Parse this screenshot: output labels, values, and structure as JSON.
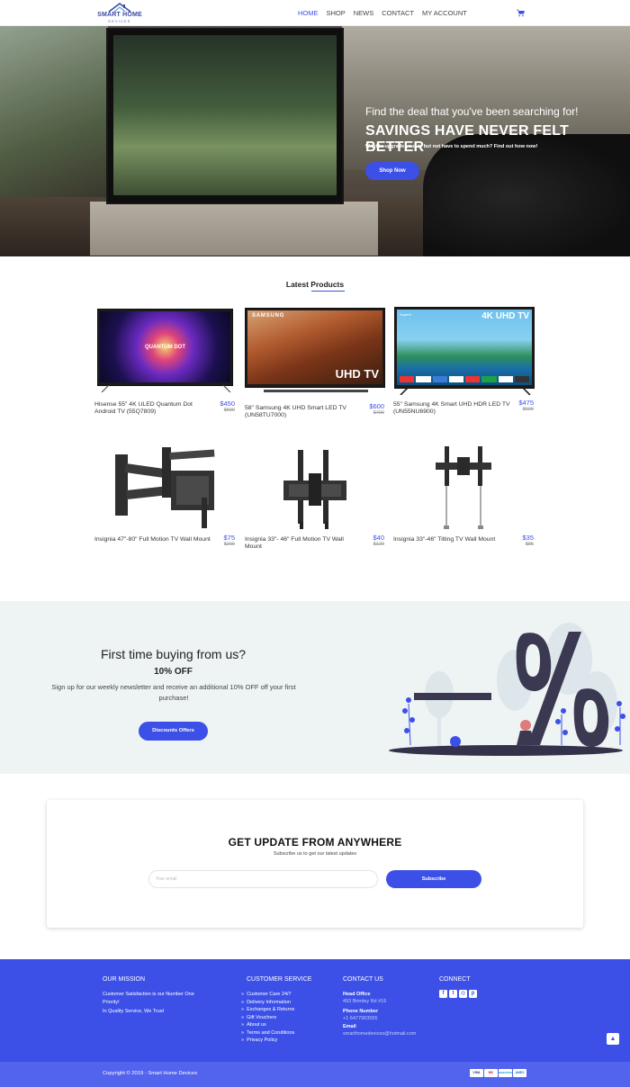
{
  "brand": {
    "name": "SMART HOME",
    "tagline": "DEVICES"
  },
  "nav": {
    "items": [
      {
        "label": "HOME",
        "active": true
      },
      {
        "label": "SHOP",
        "active": false
      },
      {
        "label": "NEWS",
        "active": false
      },
      {
        "label": "CONTACT",
        "active": false
      },
      {
        "label": "MY ACCOUNT",
        "active": false
      }
    ],
    "cart_icon": "cart-icon"
  },
  "hero": {
    "subtitle": "Find the deal that you've been searching for!",
    "title": "SAVINGS HAVE NEVER FELT BETTER",
    "description": "Want to upgrade your tv but not have to spend much? Find out how now!",
    "button": "Shop Now"
  },
  "latest": {
    "title": "Latest Products",
    "products": [
      {
        "name": "Hisense 55\" 4K ULED Quantum Dot Android TV (55Q7809)",
        "price": "$450",
        "old_price": "$590"
      },
      {
        "name": "58\" Samsung 4K UHD Smart LED TV (UN58TU7000)",
        "price": "$600",
        "old_price": "$790"
      },
      {
        "name": "55\" Samsung 4K Smart UHD HDR LED TV (UN55NU6900)",
        "price": "$475",
        "old_price": "$600"
      },
      {
        "name": "Insignia 47\"-80\" Full Motion TV Wall Mount",
        "price": "$75",
        "old_price": "$200"
      },
      {
        "name": "Insignia 33\"- 46\" Full Motion TV Wall Mount",
        "price": "$40",
        "old_price": "$120"
      },
      {
        "name": "Insignia 33\"-46\" Tilting TV Wall Mount",
        "price": "$35",
        "old_price": "$85"
      }
    ],
    "screen_labels": {
      "quantum": "QUANTUM DOT",
      "samsung": "SAMSUNG",
      "uhd": "UHD TV",
      "uhd4k": "4K UHD TV",
      "superb": "Superb"
    }
  },
  "offer": {
    "title": "First time buying from us?",
    "discount": "10% OFF",
    "description": "Sign up for our weekly newsletter and receive an additional 10% OFF off your first purchase!",
    "button": "Discounts Offers"
  },
  "update": {
    "title": "GET UPDATE FROM ANYWHERE",
    "subtitle": "Subscribe us to get our latest updates",
    "email_placeholder": "Your email",
    "button": "Subscribe"
  },
  "footer": {
    "mission": {
      "heading": "OUR MISSION",
      "line1": "Customer Satisfaction is our Number One Priority!",
      "line2": "In Quality Service, We Trust"
    },
    "service": {
      "heading": "CUSTOMER SERVICE",
      "items": [
        "Customer Care 24/7",
        "Delivery Information",
        "Exchanges & Returns",
        "Gift Vouchers",
        "About us",
        "Terms and Conditions",
        "Privacy Policy"
      ]
    },
    "contact": {
      "heading": "CONTACT US",
      "office_label": "Head Office",
      "office": "493 Brimley Rd #16",
      "phone_label": "Phone Number",
      "phone": "+1 6477963555",
      "email_label": "Email",
      "email": "smarthomedevices@hotmail.com"
    },
    "connect": {
      "heading": "CONNECT",
      "icons": [
        "facebook-icon",
        "twitter-icon",
        "instagram-icon",
        "pinterest-icon"
      ]
    },
    "copyright": "Copyright © 2019 - Smart Home Devices",
    "payments": [
      "VISA",
      "MC",
      "MAESTRO",
      "AMEX"
    ]
  },
  "colors": {
    "accent": "#3c50e8",
    "footer": "#3c50e8",
    "offer_bg": "#eef3f4"
  }
}
